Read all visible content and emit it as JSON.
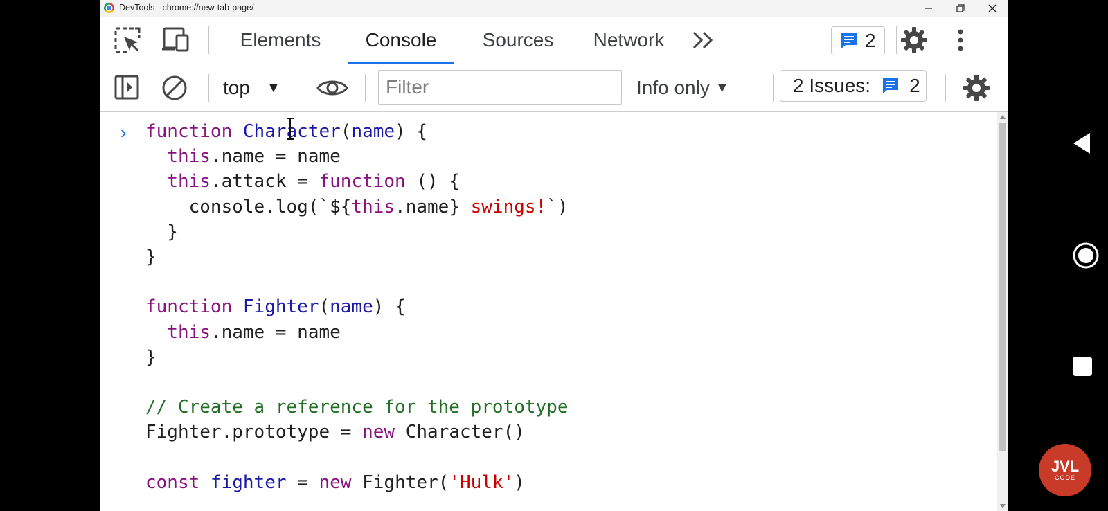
{
  "window": {
    "title": "DevTools - chrome://new-tab-page/"
  },
  "tabs": [
    {
      "label": "Elements"
    },
    {
      "label": "Console"
    },
    {
      "label": "Sources"
    },
    {
      "label": "Network"
    }
  ],
  "header": {
    "messages_count": "2"
  },
  "toolbar": {
    "context": "top",
    "filter_placeholder": "Filter",
    "levels": "Info only",
    "issues_label": "2 Issues:",
    "issues_count": "2"
  },
  "console": {
    "prompt": "›",
    "lines": [
      [
        {
          "t": "function",
          "c": "kw"
        },
        {
          "t": " "
        },
        {
          "t": "Character",
          "c": "fn"
        },
        {
          "t": "("
        },
        {
          "t": "name",
          "c": "fn"
        },
        {
          "t": ") {"
        }
      ],
      [
        {
          "t": "  "
        },
        {
          "t": "this",
          "c": "kw"
        },
        {
          "t": ".name = name"
        }
      ],
      [
        {
          "t": "  "
        },
        {
          "t": "this",
          "c": "kw"
        },
        {
          "t": ".attack = "
        },
        {
          "t": "function",
          "c": "kw"
        },
        {
          "t": " () {"
        }
      ],
      [
        {
          "t": "    console.log(`${"
        },
        {
          "t": "this",
          "c": "kw"
        },
        {
          "t": ".name} "
        },
        {
          "t": "swings!",
          "c": "str"
        },
        {
          "t": "`)"
        }
      ],
      [
        {
          "t": "  }"
        }
      ],
      [
        {
          "t": "}"
        }
      ],
      [
        {
          "t": ""
        }
      ],
      [
        {
          "t": "function",
          "c": "kw"
        },
        {
          "t": " "
        },
        {
          "t": "Fighter",
          "c": "fn"
        },
        {
          "t": "("
        },
        {
          "t": "name",
          "c": "fn"
        },
        {
          "t": ") {"
        }
      ],
      [
        {
          "t": "  "
        },
        {
          "t": "this",
          "c": "kw"
        },
        {
          "t": ".name = name"
        }
      ],
      [
        {
          "t": "}"
        }
      ],
      [
        {
          "t": ""
        }
      ],
      [
        {
          "t": "// Create a reference for the prototype",
          "c": "cm"
        }
      ],
      [
        {
          "t": "Fighter.prototype = "
        },
        {
          "t": "new",
          "c": "kw"
        },
        {
          "t": " Character()"
        }
      ],
      [
        {
          "t": ""
        }
      ],
      [
        {
          "t": "const",
          "c": "kw"
        },
        {
          "t": " "
        },
        {
          "t": "fighter",
          "c": "fn"
        },
        {
          "t": " = "
        },
        {
          "t": "new",
          "c": "kw"
        },
        {
          "t": " Fighter("
        },
        {
          "t": "'Hulk'",
          "c": "str"
        },
        {
          "t": ")"
        }
      ]
    ]
  },
  "watermark": {
    "text": "JVL",
    "sub": "CODE"
  }
}
